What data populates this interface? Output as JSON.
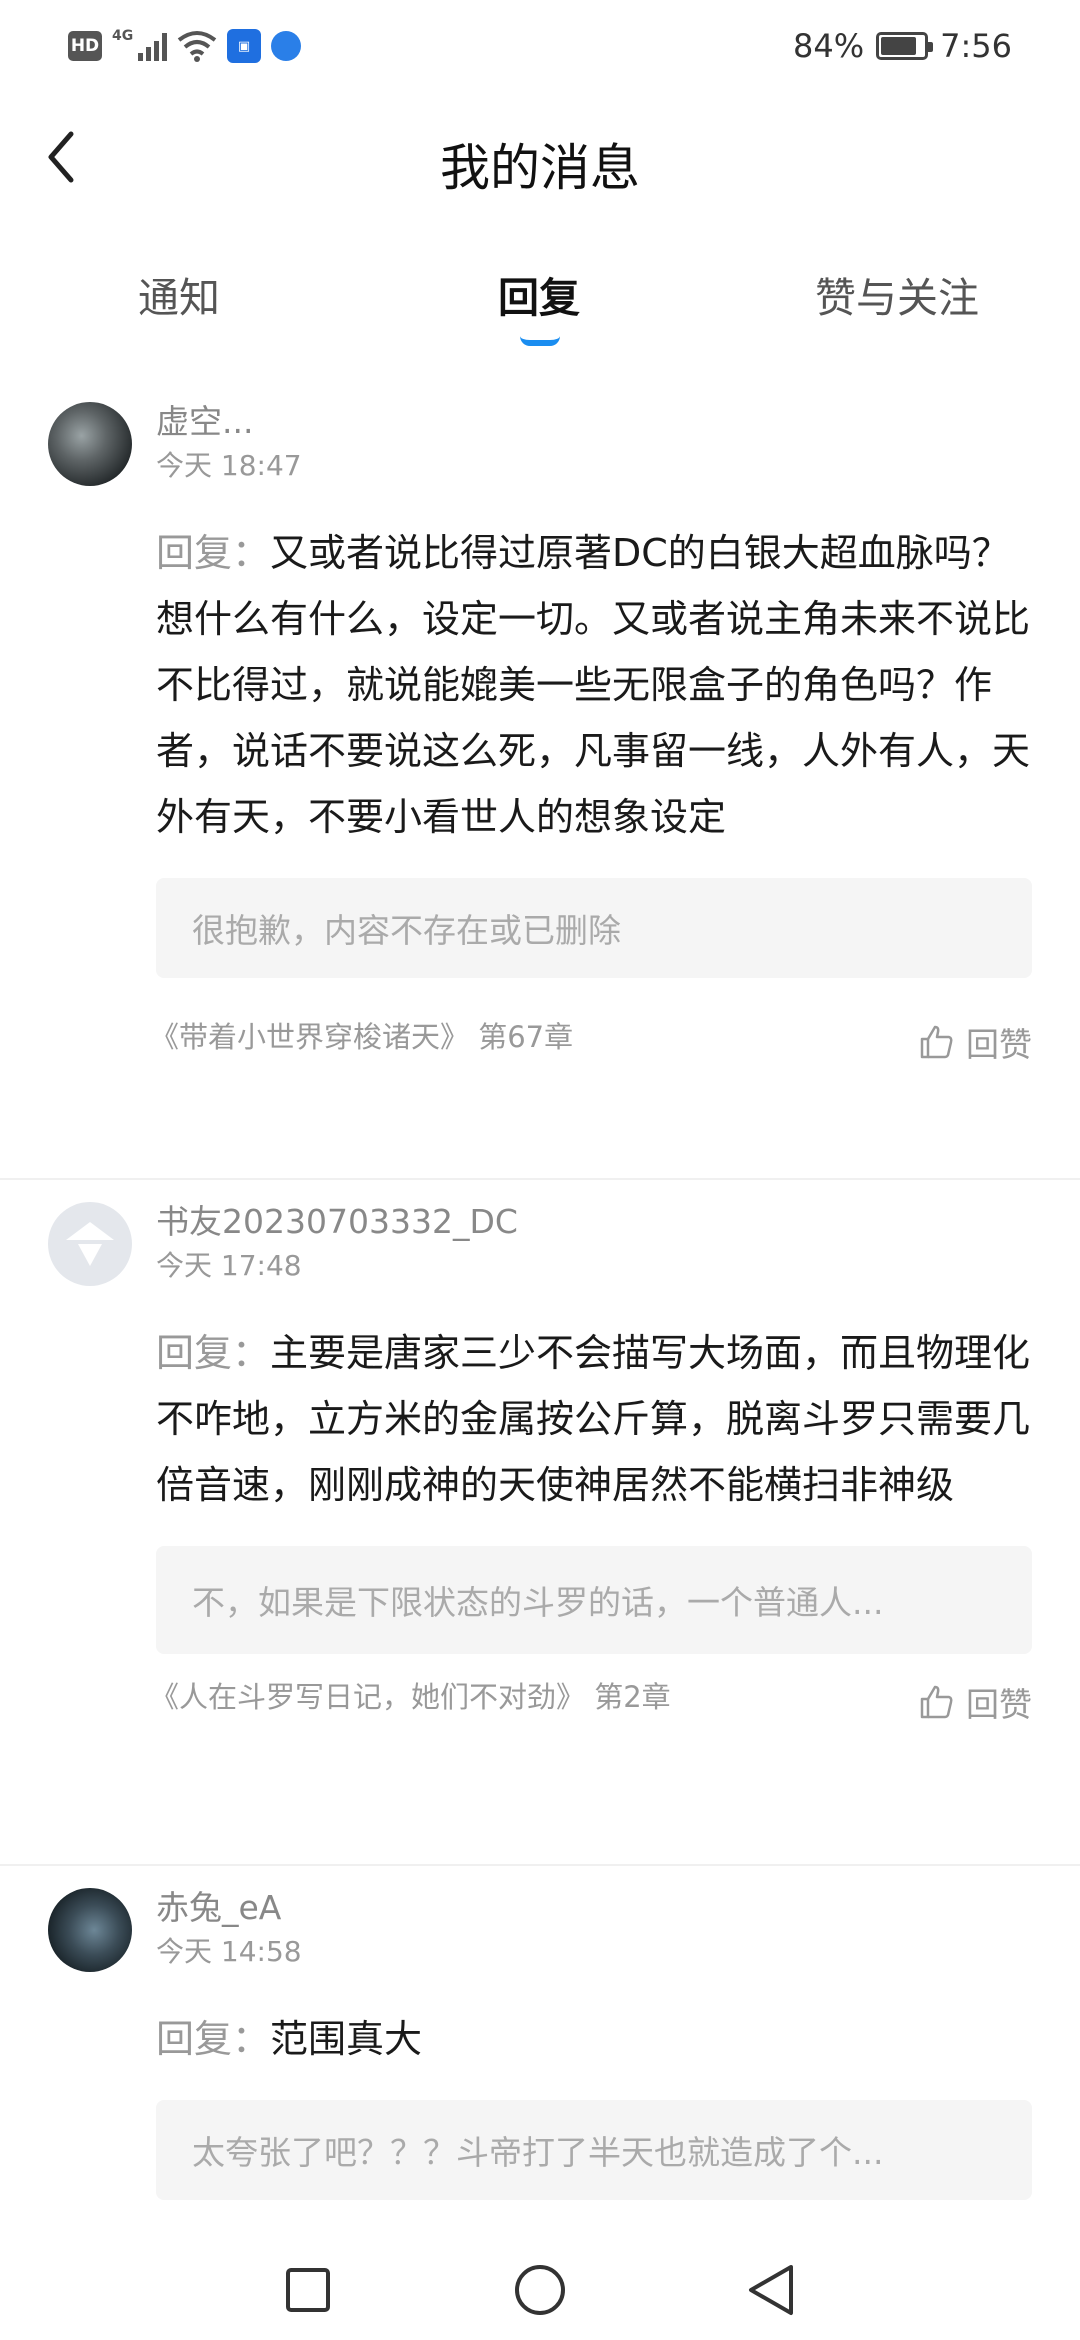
{
  "status_bar": {
    "hd_label": "HD",
    "network_label": "4G",
    "battery_text": "84%",
    "battery_level": 0.84,
    "time": "7:56"
  },
  "header": {
    "title": "我的消息"
  },
  "tabs": [
    {
      "label": "通知",
      "active": false
    },
    {
      "label": "回复",
      "active": true
    },
    {
      "label": "赞与关注",
      "active": false
    }
  ],
  "accent_color": "#1a8df0",
  "reply_prefix": "回复：",
  "like_label": "回赞",
  "messages": [
    {
      "username": "虚空...",
      "time": "今天 18:47",
      "reply_text": "又或者说比得过原著DC的白银大超血脉吗？想什么有什么，设定一切。又或者说主角未来不说比不比得过，就说能媲美一些无限盒子的角色吗？作者，说话不要说这么死，凡事留一线，人外有人，天外有天，不要小看世人的想象设定",
      "quote": "很抱歉，内容不存在或已删除",
      "chapter": "《带着小世界穿梭诸天》 第67章"
    },
    {
      "username": "书友20230703332_DC",
      "time": "今天 17:48",
      "reply_text": "主要是唐家三少不会描写大场面，而且物理化不咋地，立方米的金属按公斤算，脱离斗罗只需要几倍音速，刚刚成神的天使神居然不能横扫非神级",
      "quote": "不，如果是下限状态的斗罗的话，一个普通人...",
      "chapter": "《人在斗罗写日记，她们不对劲》 第2章"
    },
    {
      "username": "赤兔_eA",
      "time": "今天 14:58",
      "reply_text": "范围真大",
      "quote": "太夸张了吧？？？斗帝打了半天也就造成了个...",
      "chapter": ""
    }
  ]
}
